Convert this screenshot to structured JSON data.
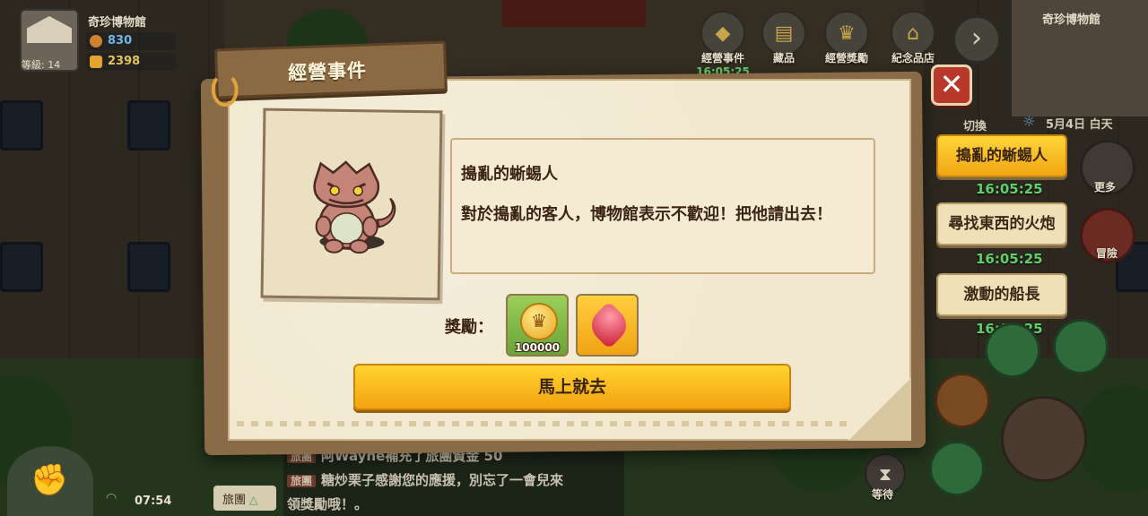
{
  "hud": {
    "museum_name": "奇珍博物館",
    "level": "等級: 14",
    "visitors": "830",
    "gold": "2398"
  },
  "top_menu": [
    {
      "label": "經營事件",
      "timer": "16:05:25"
    },
    {
      "label": "藏品",
      "timer": ""
    },
    {
      "label": "經營獎勵",
      "timer": ""
    },
    {
      "label": "紀念品店",
      "timer": ""
    }
  ],
  "minimap": {
    "title": "奇珍博物館",
    "switch_label": "切換",
    "date": "5月4日 白天"
  },
  "side_events": [
    {
      "label": "搗亂的蜥蜴人",
      "timer": "16:05:25",
      "active": true
    },
    {
      "label": "尋找東西的火炮",
      "timer": "16:05:25",
      "active": false
    },
    {
      "label": "激動的船長",
      "timer": "16:05:25",
      "active": false
    }
  ],
  "side_buttons": {
    "more_label": "更多",
    "adventure_label": "冒險",
    "wait_label": "等待"
  },
  "modal": {
    "title": "經營事件",
    "close_symbol": "✕",
    "event_name": "搗亂的蜥蜴人",
    "event_desc": "對於搗亂的客人，博物館表示不歡迎！把他請出去！",
    "reward_label": "獎勵：",
    "rewards": [
      {
        "name": "gold-coin",
        "amount": "100000"
      },
      {
        "name": "heart-gem",
        "amount": ""
      }
    ],
    "go_button": "馬上就去"
  },
  "bottom": {
    "clock": "07:54",
    "tour_button": "旅團",
    "chat": [
      {
        "tag": "旅團",
        "text": "阿Wayne補充了旅團資金 50"
      },
      {
        "tag": "旅團",
        "text": "糖炒栗子感謝您的應援，別忘了一會兒來"
      },
      {
        "tag": "",
        "text": "領獎勵哦！。"
      }
    ]
  },
  "colors": {
    "accent_yellow": "#f3a30f",
    "timer_green": "#5fd06a",
    "close_red": "#b8392b",
    "parchment": "#f2e8cf"
  }
}
